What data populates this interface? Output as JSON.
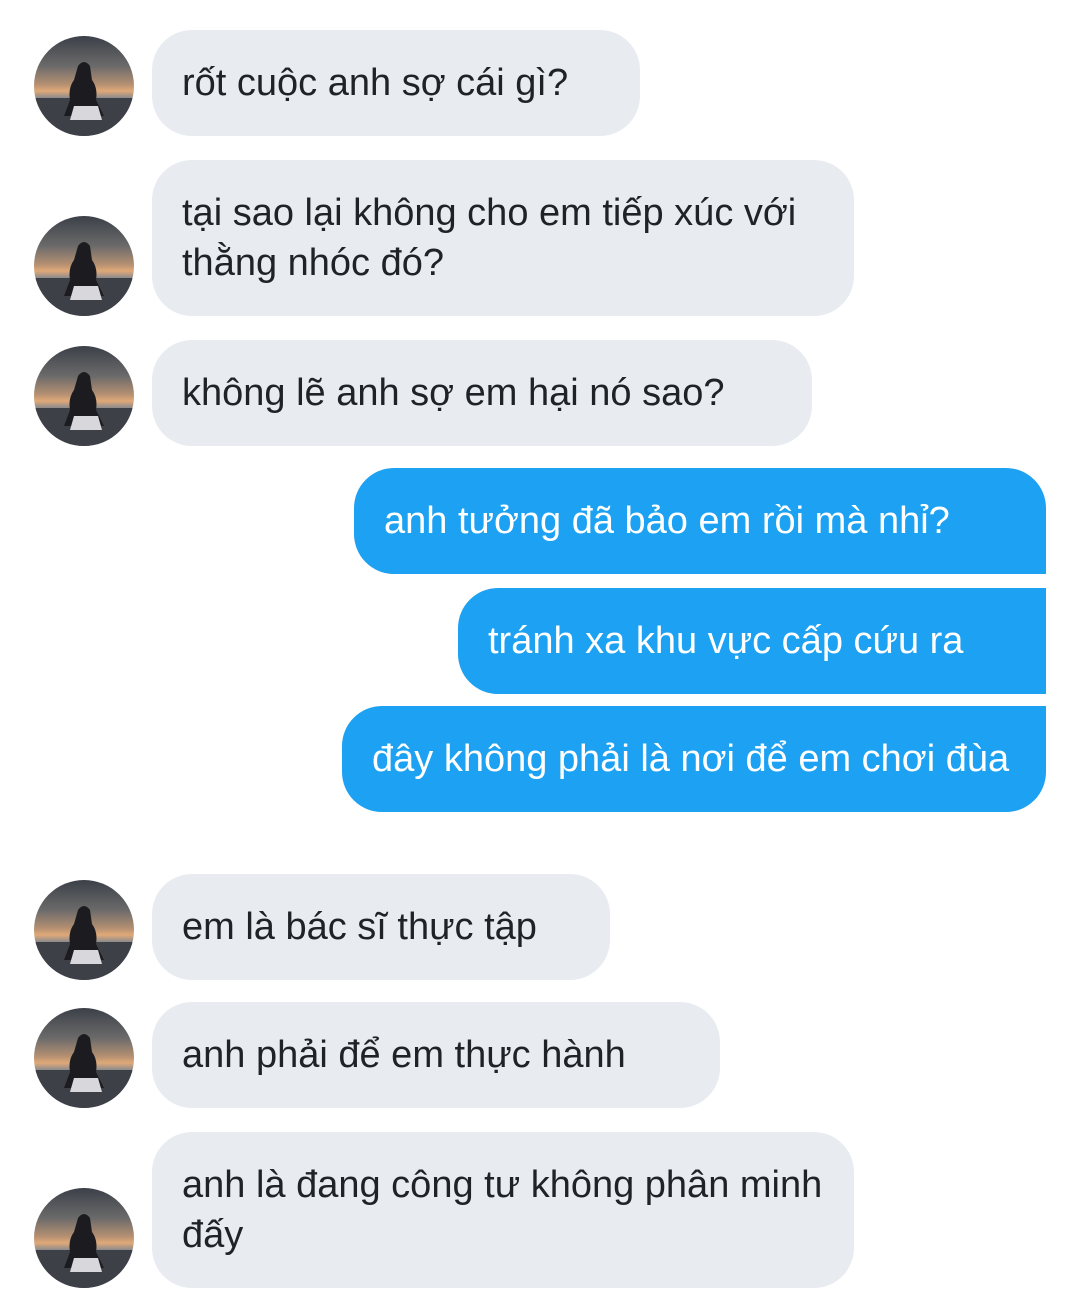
{
  "messages": [
    {
      "side": "in",
      "text": "rốt cuộc anh sợ cái gì?"
    },
    {
      "side": "in",
      "text": "tại sao lại không cho em tiếp xúc với thằng nhóc đó?"
    },
    {
      "side": "in",
      "text": "không lẽ anh sợ em hại nó sao?"
    },
    {
      "side": "out",
      "text": "anh tưởng đã bảo em rồi mà nhỉ?"
    },
    {
      "side": "out",
      "text": "tránh xa khu vực cấp cứu ra"
    },
    {
      "side": "out",
      "text": "đây không phải là nơi để em chơi đùa"
    },
    {
      "side": "in",
      "text": "em là bác sĩ thực tập"
    },
    {
      "side": "in",
      "text": "anh phải để em thực hành"
    },
    {
      "side": "in",
      "text": "anh là đang công tư không phân minh đấy"
    }
  ],
  "avatar_icon": "contact-avatar-photo",
  "colors": {
    "incoming_bubble": "#e8ecf0",
    "outgoing_bubble": "#1da1f2",
    "incoming_text": "#1f2328",
    "outgoing_text": "#ffffff"
  }
}
